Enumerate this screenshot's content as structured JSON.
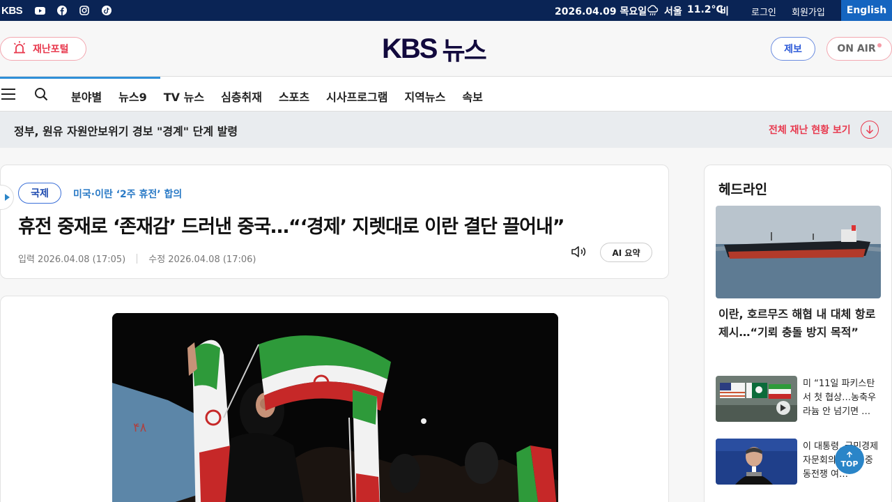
{
  "topbar": {
    "logo": "KBS",
    "date": "2026.04.09 목요일",
    "city": "서울",
    "temperature": "11.2°C",
    "weather": "비",
    "login": "로그인",
    "signup": "회원가입",
    "english": "English",
    "social": [
      "youtube-icon",
      "facebook-icon",
      "instagram-icon",
      "tiktok-icon"
    ]
  },
  "header": {
    "disaster_portal": "재난포털",
    "logo_kbs": "KBS",
    "logo_news": "뉴스",
    "tip": "제보",
    "on_air": "ON AIR"
  },
  "nav": {
    "items": [
      "분야별",
      "뉴스9",
      "TV 뉴스",
      "심층취재",
      "스포츠",
      "시사프로그램",
      "지역뉴스",
      "속보"
    ]
  },
  "alert": {
    "message": "정부, 원유 자원안보위기 경보 \"경계\" 단계 발령",
    "view_all": "전체 재난 현황 보기"
  },
  "article": {
    "category": "국제",
    "topic": "미국·이란 ‘2주 휴전’ 합의",
    "headline": "휴전 중재로 ‘존재감’ 드러낸 중국…“‘경제’ 지렛대로 이란 결단 끌어내”",
    "published": "입력 2026.04.08 (17:05)",
    "modified": "수정 2026.04.08 (17:06)",
    "ai_summary": "AI 요약"
  },
  "sidebar": {
    "title": "헤드라인",
    "main_headline": "이란, 호르무즈 해협 내 대체 항로 제시…“기뢰 충돌 방지 목적”",
    "items": [
      {
        "text": "미 “11일 파키스탄서 첫 협상…농축우라늄 안 넘기면 …"
      },
      {
        "text": "이 대통령, 국민경제자문회의 주재…중동전쟁 여…"
      }
    ]
  },
  "top_button": "TOP",
  "colors": {
    "topbar_bg": "#0a2455",
    "english_bg": "#1565c0",
    "accent_red": "#e8394e",
    "accent_blue": "#2a7ac6",
    "progress": "#2f8fd8"
  }
}
